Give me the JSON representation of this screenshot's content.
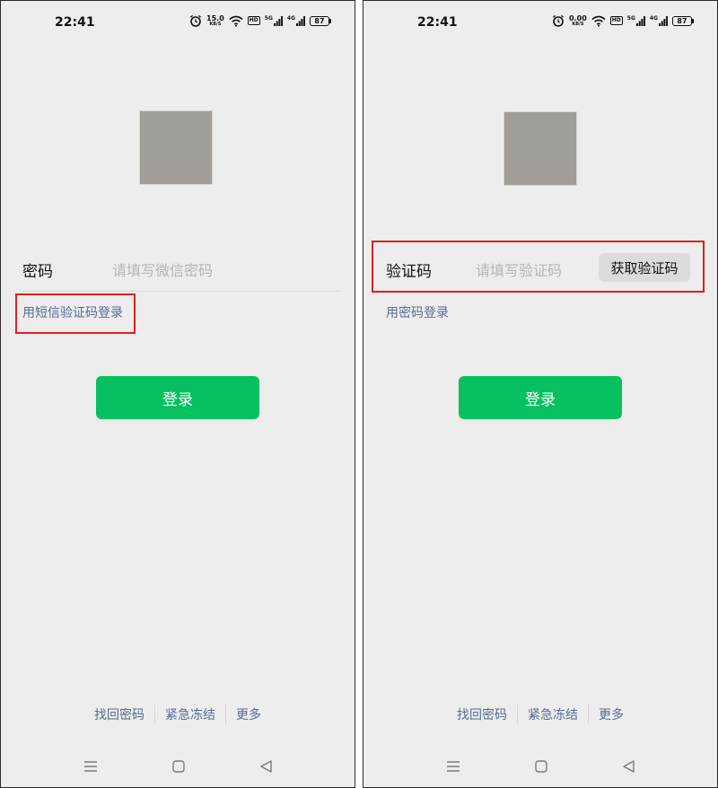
{
  "left": {
    "status": {
      "time": "22:41",
      "speed_value": "15.0",
      "speed_unit": "KB/S",
      "hd": "HD",
      "net1": "5G",
      "net2": "4G",
      "battery": "87"
    },
    "field": {
      "label": "密码",
      "placeholder": "请填写微信密码"
    },
    "switch_link": "用短信验证码登录",
    "login_button": "登录",
    "footer": {
      "link1": "找回密码",
      "link2": "紧急冻结",
      "link3": "更多"
    }
  },
  "right": {
    "status": {
      "time": "22:41",
      "speed_value": "0.00",
      "speed_unit": "KB/S",
      "hd": "HD",
      "net1": "5G",
      "net2": "4G",
      "battery": "87"
    },
    "field": {
      "label": "验证码",
      "placeholder": "请填写验证码",
      "button": "获取验证码"
    },
    "switch_link": "用密码登录",
    "login_button": "登录",
    "footer": {
      "link1": "找回密码",
      "link2": "紧急冻结",
      "link3": "更多"
    }
  },
  "icons": {
    "status": [
      "alarm-icon",
      "wifi-icon",
      "signal-icon",
      "battery-icon"
    ],
    "nav": [
      "menu-icon",
      "home-icon",
      "back-icon"
    ]
  },
  "colors": {
    "primary_button": "#07c160",
    "link": "#566b94",
    "highlight": "#e02020",
    "screen_background": "#ededed"
  }
}
